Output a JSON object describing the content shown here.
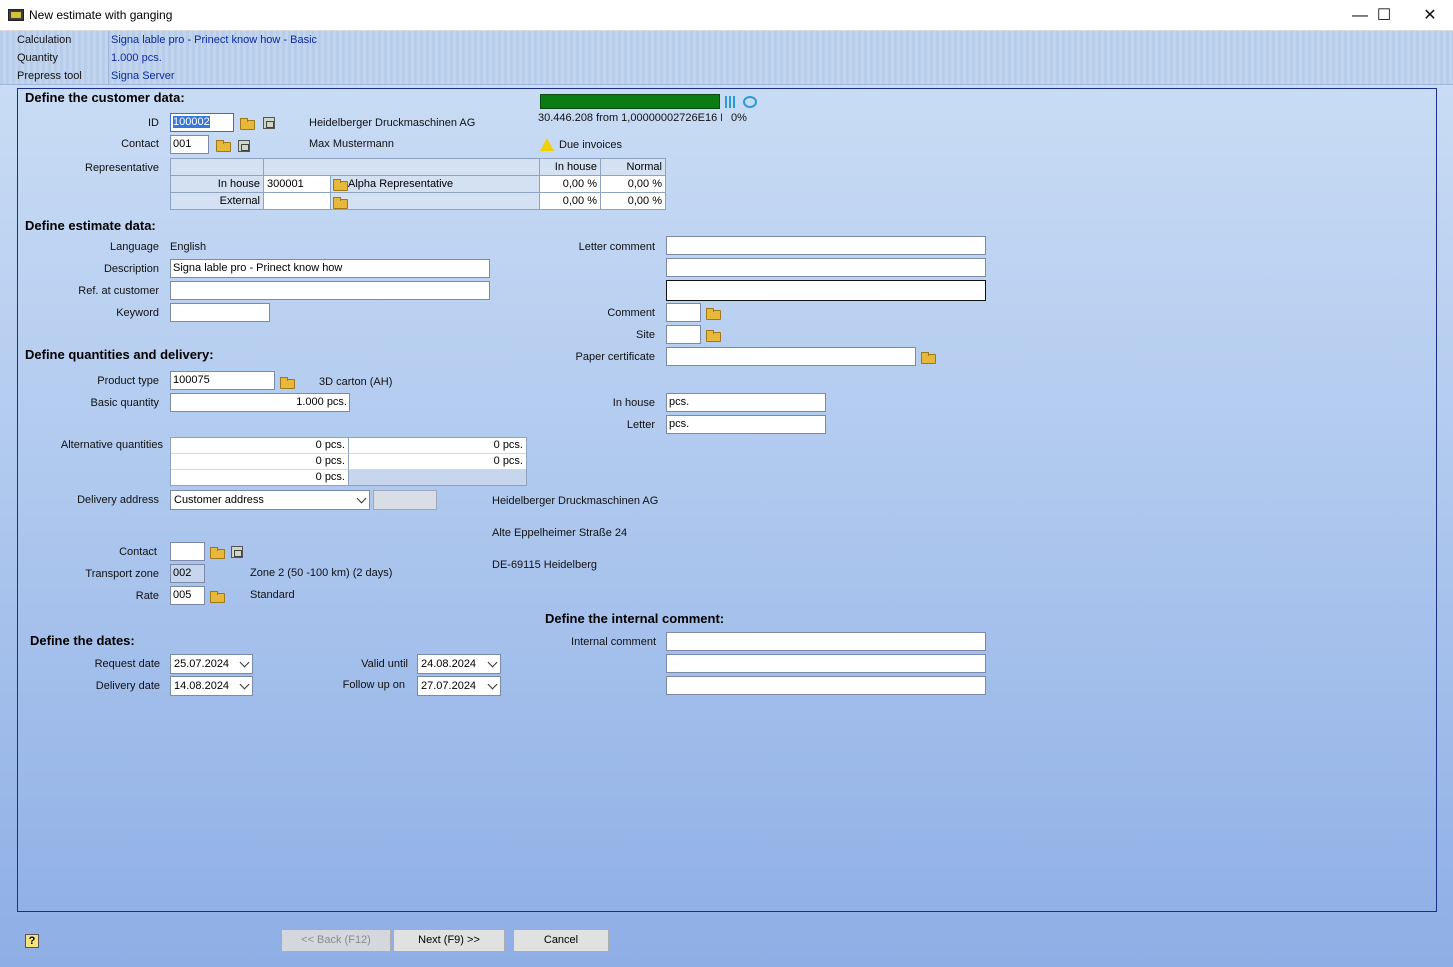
{
  "window": {
    "title": "New estimate with ganging",
    "minimize": "—",
    "maximize": "☐",
    "close": "✕"
  },
  "info": {
    "calculation_label": "Calculation",
    "calculation_value": "Signa lable pro - Prinect know how - Basic",
    "quantity_label": "Quantity",
    "quantity_value": "1.000 pcs.",
    "prepress_label": "Prepress tool",
    "prepress_value": "Signa Server"
  },
  "customer": {
    "heading": "Define the customer data:",
    "id_label": "ID",
    "id_value": "100002",
    "company": "Heidelberger Druckmaschinen AG",
    "contact_label": "Contact",
    "contact_value": "001",
    "contact_name": "Max Mustermann",
    "representative_label": "Representative",
    "rep_table": {
      "col_inhouse": "In house",
      "col_normal": "Normal",
      "rows": [
        {
          "label": "In house",
          "id": "300001",
          "name": "Alpha Representative",
          "inhouse": "0,00 %",
          "normal": "0,00 %"
        },
        {
          "label": "External",
          "id": "",
          "name": "",
          "inhouse": "0,00 %",
          "normal": "0,00 %"
        }
      ]
    },
    "credit_text": "30.446.208 from 1,00000002726E16 E",
    "credit_percent": "0%",
    "credit_fraction": 1.0,
    "due_invoices": "Due invoices"
  },
  "estimate": {
    "heading": "Define estimate data:",
    "language_label": "Language",
    "language_value": "English",
    "description_label": "Description",
    "description_value": "Signa lable pro - Prinect know how",
    "ref_label": "Ref. at customer",
    "ref_value": "",
    "keyword_label": "Keyword",
    "keyword_value": "",
    "letter_comment_label": "Letter comment",
    "comment_label": "Comment",
    "site_label": "Site",
    "paper_cert_label": "Paper certificate"
  },
  "quantities": {
    "heading": "Define quantities and delivery:",
    "product_type_label": "Product type",
    "product_type_value": "100075",
    "product_type_name": "3D carton (AH)",
    "basic_qty_label": "Basic quantity",
    "basic_qty_value": "1.000 pcs.",
    "inhouse_label": "In house",
    "inhouse_value": "pcs.",
    "letter_label": "Letter",
    "letter_value": "pcs.",
    "alt_label": "Alternative quantities",
    "alt_values": [
      "0 pcs.",
      "0 pcs.",
      "0 pcs.",
      "0 pcs.",
      "0 pcs."
    ],
    "delivery_label": "Delivery address",
    "delivery_value": "Customer address",
    "addr_line1": "Heidelberger Druckmaschinen AG",
    "addr_line2": "Alte Eppelheimer Straße 24",
    "addr_line3": "DE-69115 Heidelberg",
    "contact_label": "Contact",
    "contact_value": "",
    "zone_label": "Transport zone",
    "zone_value": "002",
    "zone_name": "Zone 2 (50 -100 km) (2 days)",
    "rate_label": "Rate",
    "rate_value": "005",
    "rate_name": "Standard"
  },
  "internal": {
    "heading": "Define the internal comment:",
    "label": "Internal comment"
  },
  "dates": {
    "heading": "Define the dates:",
    "request_label": "Request date",
    "request_value": "25.07.2024",
    "delivery_label": "Delivery date",
    "delivery_value": "14.08.2024",
    "valid_label": "Valid until",
    "valid_value": "24.08.2024",
    "followup_label": "Follow up on",
    "followup_value": "27.07.2024"
  },
  "buttons": {
    "back": "<< Back (F12)",
    "next": "Next (F9) >>",
    "cancel": "Cancel",
    "help": "?"
  },
  "colors": {
    "accent": "#1c2f8a",
    "progress": "#0b7c14",
    "link": "#0a2aa0"
  }
}
